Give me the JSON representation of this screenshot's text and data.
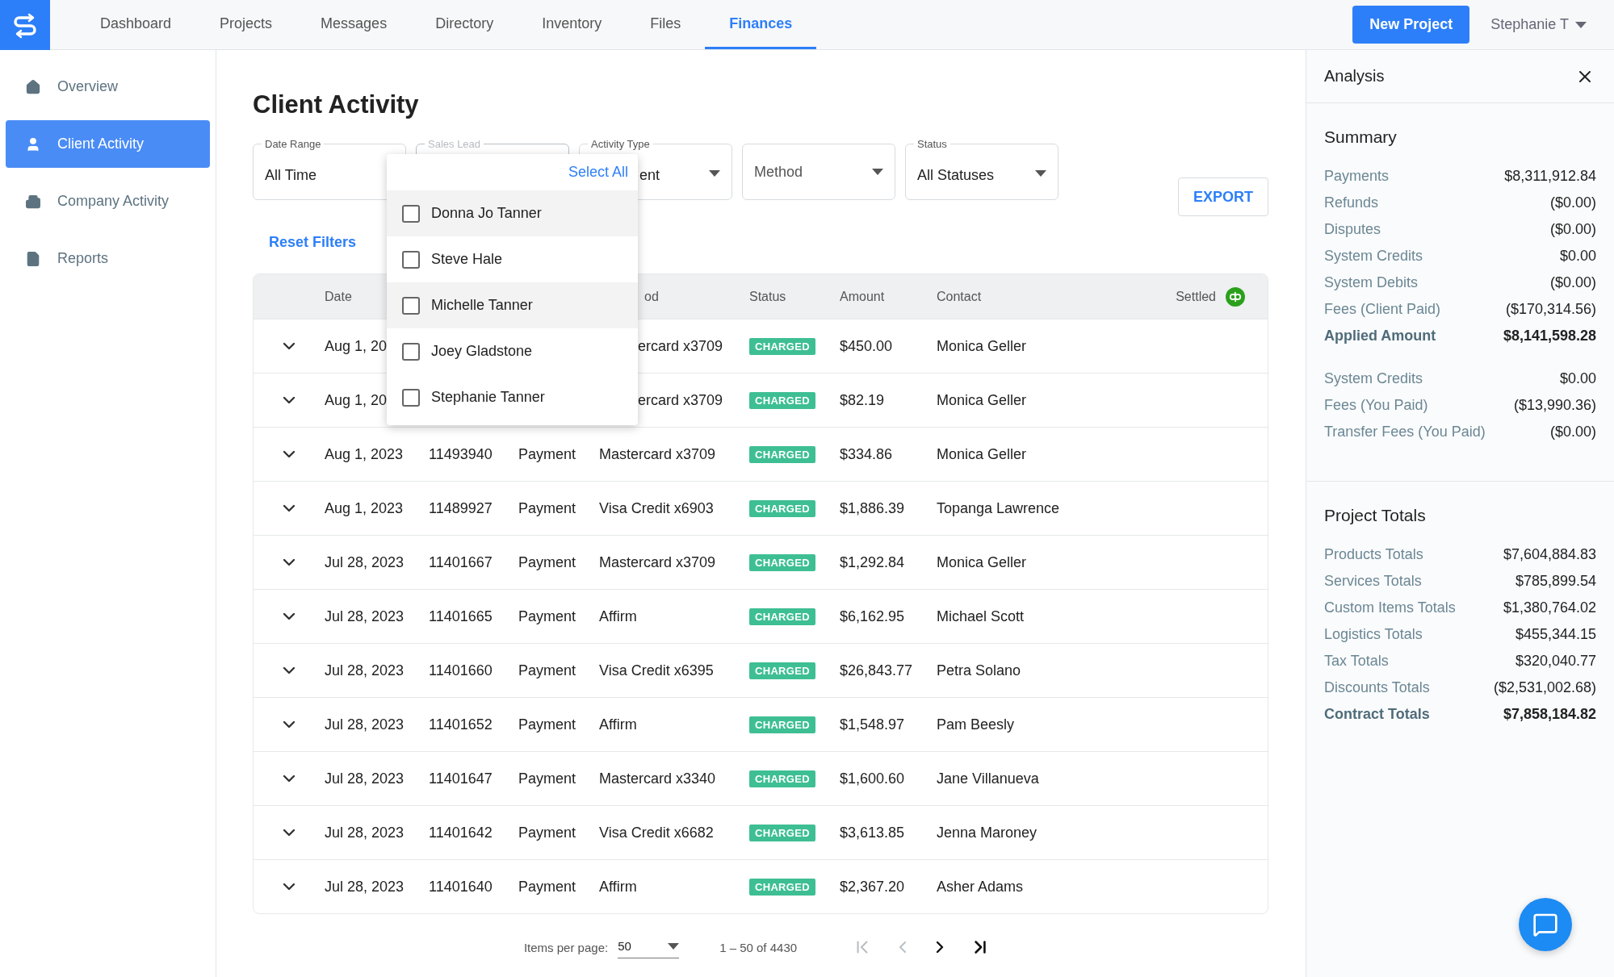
{
  "topbar": {
    "tabs": [
      {
        "label": "Dashboard",
        "selected": false
      },
      {
        "label": "Projects",
        "selected": false
      },
      {
        "label": "Messages",
        "selected": false
      },
      {
        "label": "Directory",
        "selected": false
      },
      {
        "label": "Inventory",
        "selected": false
      },
      {
        "label": "Files",
        "selected": false
      },
      {
        "label": "Finances",
        "selected": true
      }
    ],
    "new_project_button": "New Project",
    "user_menu": "Stephanie T"
  },
  "sidebar": {
    "items": [
      {
        "label": "Overview",
        "selected": false
      },
      {
        "label": "Client Activity",
        "selected": true
      },
      {
        "label": "Company Activity",
        "selected": false
      },
      {
        "label": "Reports",
        "selected": false
      }
    ]
  },
  "page": {
    "title": "Client Activity",
    "filters": [
      {
        "label": "Date Range",
        "value": "All Time",
        "open": false
      },
      {
        "label": "Sales Lead",
        "open": true
      },
      {
        "label": "Activity Type",
        "value": "ent",
        "open": false
      },
      {
        "placeholder": "Method",
        "open": false
      },
      {
        "label": "Status",
        "value": "All Statuses",
        "open": false
      }
    ],
    "sales_lead_menu": {
      "select_all": "Select All",
      "options": [
        {
          "label": "Donna Jo Tanner",
          "checked": false,
          "highlighted": true
        },
        {
          "label": "Steve Hale",
          "checked": false,
          "highlighted": false
        },
        {
          "label": "Michelle Tanner",
          "checked": false,
          "highlighted": true
        },
        {
          "label": "Joey Gladstone",
          "checked": false,
          "highlighted": false
        },
        {
          "label": "Stephanie Tanner",
          "checked": false,
          "highlighted": false
        }
      ]
    },
    "export_button": "EXPORT",
    "reset_filters": "Reset Filters",
    "table": {
      "columns": {
        "date": "Date",
        "method": "od",
        "status": "Status",
        "amount": "Amount",
        "contact": "Contact",
        "settled": "Settled"
      },
      "rows": [
        {
          "date": "Aug 1, 20",
          "method": "ercard x3709",
          "status": "CHARGED",
          "amount": "$450.00",
          "contact": "Monica Geller"
        },
        {
          "date": "Aug 1, 20",
          "method": "ercard x3709",
          "status": "CHARGED",
          "amount": "$82.19",
          "contact": "Monica Geller"
        },
        {
          "date": "Aug 1, 2023",
          "id": "11493940",
          "type": "Payment",
          "method": "Mastercard x3709",
          "status": "CHARGED",
          "amount": "$334.86",
          "contact": "Monica Geller"
        },
        {
          "date": "Aug 1, 2023",
          "id": "11489927",
          "type": "Payment",
          "method": "Visa Credit x6903",
          "status": "CHARGED",
          "amount": "$1,886.39",
          "contact": "Topanga Lawrence"
        },
        {
          "date": "Jul 28, 2023",
          "id": "11401667",
          "type": "Payment",
          "method": "Mastercard x3709",
          "status": "CHARGED",
          "amount": "$1,292.84",
          "contact": "Monica Geller"
        },
        {
          "date": "Jul 28, 2023",
          "id": "11401665",
          "type": "Payment",
          "method": "Affirm",
          "status": "CHARGED",
          "amount": "$6,162.95",
          "contact": "Michael Scott"
        },
        {
          "date": "Jul 28, 2023",
          "id": "11401660",
          "type": "Payment",
          "method": "Visa Credit x6395",
          "status": "CHARGED",
          "amount": "$26,843.77",
          "contact": "Petra Solano"
        },
        {
          "date": "Jul 28, 2023",
          "id": "11401652",
          "type": "Payment",
          "method": "Affirm",
          "status": "CHARGED",
          "amount": "$1,548.97",
          "contact": "Pam Beesly"
        },
        {
          "date": "Jul 28, 2023",
          "id": "11401647",
          "type": "Payment",
          "method": "Mastercard x3340",
          "status": "CHARGED",
          "amount": "$1,600.60",
          "contact": "Jane Villanueva"
        },
        {
          "date": "Jul 28, 2023",
          "id": "11401642",
          "type": "Payment",
          "method": "Visa Credit x6682",
          "status": "CHARGED",
          "amount": "$3,613.85",
          "contact": "Jenna Maroney"
        },
        {
          "date": "Jul 28, 2023",
          "id": "11401640",
          "type": "Payment",
          "method": "Affirm",
          "status": "CHARGED",
          "amount": "$2,367.20",
          "contact": "Asher Adams"
        }
      ]
    },
    "pagination": {
      "label": "Items per page:",
      "page_size": "50",
      "range": "1 – 50 of 4430",
      "buttons": [
        {
          "kind": "first",
          "disabled": true
        },
        {
          "kind": "prev",
          "disabled": true
        },
        {
          "kind": "next",
          "disabled": false
        },
        {
          "kind": "last",
          "disabled": false
        }
      ]
    }
  },
  "analysis": {
    "title": "Analysis",
    "sections": [
      {
        "title": "Summary",
        "groups": [
          [
            {
              "label": "Payments",
              "value": "$8,311,912.84",
              "kind": "line"
            },
            {
              "label": "Refunds",
              "value": "($0.00)",
              "kind": "line"
            },
            {
              "label": "Disputes",
              "value": "($0.00)",
              "kind": "line"
            },
            {
              "label": "System Credits",
              "value": "$0.00",
              "kind": "line"
            },
            {
              "label": "System Debits",
              "value": "($0.00)",
              "kind": "line"
            },
            {
              "label": "Fees (Client Paid)",
              "value": "($170,314.56)",
              "kind": "line"
            },
            {
              "label": "Applied Amount",
              "value": "$8,141,598.28",
              "kind": "total"
            }
          ],
          [
            {
              "label": "System Credits",
              "value": "$0.00",
              "kind": "line"
            },
            {
              "label": "Fees (You Paid)",
              "value": "($13,990.36)",
              "kind": "line"
            },
            {
              "label": "Transfer Fees (You Paid)",
              "value": "($0.00)",
              "kind": "line"
            }
          ]
        ]
      },
      {
        "title": "Project Totals",
        "groups": [
          [
            {
              "label": "Products Totals",
              "value": "$7,604,884.83",
              "kind": "line"
            },
            {
              "label": "Services Totals",
              "value": "$785,899.54",
              "kind": "line"
            },
            {
              "label": "Custom Items Totals",
              "value": "$1,380,764.02",
              "kind": "line"
            },
            {
              "label": "Logistics Totals",
              "value": "$455,344.15",
              "kind": "line"
            },
            {
              "label": "Tax Totals",
              "value": "$320,040.77",
              "kind": "line"
            },
            {
              "label": "Discounts Totals",
              "value": "($2,531,002.68)",
              "kind": "line"
            },
            {
              "label": "Contract Totals",
              "value": "$7,858,184.82",
              "kind": "total"
            }
          ]
        ]
      }
    ]
  }
}
